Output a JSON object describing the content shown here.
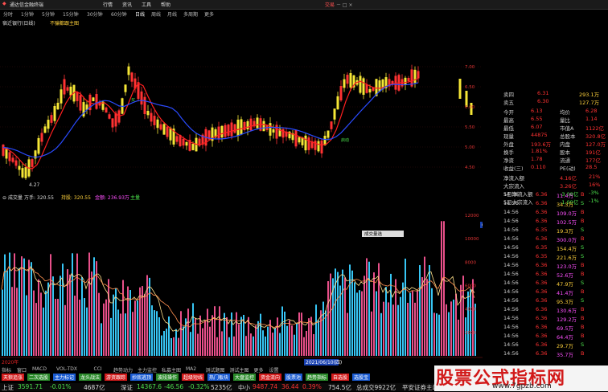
{
  "titlebar": {
    "app_title": "通达信金融终端",
    "menu": [
      "行情",
      "资讯",
      "工具",
      "帮助"
    ],
    "right": "交易"
  },
  "toolbar": {
    "periods": [
      "分时",
      "1分钟",
      "5分钟",
      "15分钟",
      "30分钟",
      "60分钟",
      "日线",
      "周线",
      "月线",
      "多周期",
      "更多"
    ],
    "active": "日线"
  },
  "infobar": {
    "stock_label": "宿迁银行(日线)",
    "indicator_label": "不骗都跟主图"
  },
  "price_axis": [
    "7.00",
    "6.50",
    "6.00",
    "5.50",
    "5.00",
    "4.50"
  ],
  "price_low_label": "4.27",
  "volume_axis": [
    "12000",
    "10000",
    "8000",
    "6000",
    "4000",
    "2000"
  ],
  "volume_header": {
    "name": "成交量",
    "vol_label": "万手: 320.55",
    "short_label": "持股: 320.55",
    "money_label": "金额: 236.93万",
    "tag": "主量"
  },
  "volume_tooltip": "成交量选",
  "volume_axis_mark": "6812",
  "date_axis": {
    "start": "2020年",
    "highlight": "2021/06/10(四)"
  },
  "quote": {
    "asks": [
      {
        "label": "卖四",
        "price": "6.31",
        "vol": "293.1万"
      },
      {
        "label": "卖五",
        "price": "6.30",
        "vol": "127.7万"
      }
    ],
    "stats": [
      {
        "l1": "今开",
        "v1": "6.13",
        "l2": "均价",
        "v2": "6.28"
      },
      {
        "l1": "最高",
        "v1": "6.55",
        "l2": "量比",
        "v2": "1.14"
      },
      {
        "l1": "最低",
        "v1": "6.07",
        "l2": "市值A",
        "v2": "1122亿"
      },
      {
        "l1": "现量",
        "v1": "44875",
        "l2": "总股本",
        "v2": "320.8亿"
      },
      {
        "l1": "外盘",
        "v1": "193.6万",
        "l2": "内盘",
        "v2": "127.0万"
      },
      {
        "l1": "换手",
        "v1": "1.81%",
        "l2": "股本",
        "v2": "191亿"
      },
      {
        "l1": "净资",
        "v1": "1.78",
        "l2": "流通",
        "v2": "177亿"
      },
      {
        "l1": "收益(三)",
        "v1": "0.110",
        "l2": "PE(动)",
        "v2": "28.5"
      }
    ],
    "flows": [
      {
        "label": "净流入额",
        "v1": "4.16亿",
        "v2": "21%"
      },
      {
        "label": "大宗流入",
        "v1": "3.26亿",
        "v2": "16%"
      },
      {
        "label": "5日净流入额",
        "v1": "-3.08亿",
        "v2": "-3%"
      },
      {
        "label": "5日大宗流入",
        "v1": "-1.09亿",
        "v2": "-1%"
      }
    ]
  },
  "ticks": [
    {
      "t": "14:56",
      "p": "6.36",
      "v": "11.4万",
      "d": "B"
    },
    {
      "t": "14:56",
      "p": "6.36",
      "v": "34.3万",
      "d": "S"
    },
    {
      "t": "14:56",
      "p": "6.36",
      "v": "109.0万",
      "d": "B"
    },
    {
      "t": "14:56",
      "p": "6.36",
      "v": "102.5万",
      "d": "B"
    },
    {
      "t": "14:56",
      "p": "6.35",
      "v": "19.3万",
      "d": "S"
    },
    {
      "t": "14:56",
      "p": "6.36",
      "v": "300.0万",
      "d": "B"
    },
    {
      "t": "14:56",
      "p": "6.35",
      "v": "154.4万",
      "d": "S"
    },
    {
      "t": "14:56",
      "p": "6.35",
      "v": "221.6万",
      "d": "S"
    },
    {
      "t": "14:56",
      "p": "6.36",
      "v": "123.0万",
      "d": "B"
    },
    {
      "t": "14:56",
      "p": "6.36",
      "v": "52.6万",
      "d": "B"
    },
    {
      "t": "14:56",
      "p": "6.36",
      "v": "47.9万",
      "d": "S"
    },
    {
      "t": "14:56",
      "p": "6.36",
      "v": "41.4万",
      "d": "B"
    },
    {
      "t": "14:56",
      "p": "6.36",
      "v": "95.3万",
      "d": "S"
    },
    {
      "t": "14:56",
      "p": "6.36",
      "v": "130.6万",
      "d": "B"
    },
    {
      "t": "14:56",
      "p": "6.36",
      "v": "129.2万",
      "d": "B"
    },
    {
      "t": "14:56",
      "p": "6.36",
      "v": "69.5万",
      "d": "B"
    },
    {
      "t": "14:56",
      "p": "6.36",
      "v": "64.4万",
      "d": "B"
    },
    {
      "t": "14:56",
      "p": "6.36",
      "v": "29.7万",
      "d": "S"
    },
    {
      "t": "14:56",
      "p": "6.36",
      "v": "35.7万",
      "d": "B"
    }
  ],
  "tabs1": [
    "指标",
    "窗口",
    "MACD",
    "VOL-TDX",
    "CCI",
    "趋势动力",
    "主力监控",
    "私募主图",
    "MA2",
    "测试题图",
    "测试主图",
    "更多",
    "设置"
  ],
  "tabs2": [
    "天狼追涨",
    "二次选股",
    "主力标记",
    "龙头战法",
    "游资跟踪",
    "抄底逃顶",
    "波段操作",
    "超级短线",
    "热门板块",
    "大盘监控",
    "资金流向",
    "股票池",
    "趋势指标",
    "自选股",
    "选股宝"
  ],
  "tabs3": [
    "扩展",
    "沪深京",
    "资金分布",
    "综合资讯",
    "行业资讯",
    "互动问答",
    "新闻个股利好"
  ],
  "statusbar": [
    {
      "label": "上证",
      "value": "3591.71",
      "chg": "-0.01%"
    },
    {
      "label": "深证",
      "value": "14367.6",
      "chg": "-0.32%"
    },
    {
      "label": "中小",
      "value": "9487.74",
      "chg": "0.39%"
    }
  ],
  "status_misc": [
    "4687亿",
    "5235亿",
    "754.5亿",
    "9922亿",
    "-46.56",
    "36.44",
    "平安证券主站"
  ],
  "watermark": {
    "title": "股票公式指标网",
    "url": "www.7gpzb.com"
  },
  "colors": {
    "up": "#ff3232",
    "down": "#f5e636",
    "ma_red": "#ff2020",
    "ma_blue": "#2a4bff",
    "vol_pink": "#e8508a",
    "vol_cyan": "#37c6f5"
  }
}
